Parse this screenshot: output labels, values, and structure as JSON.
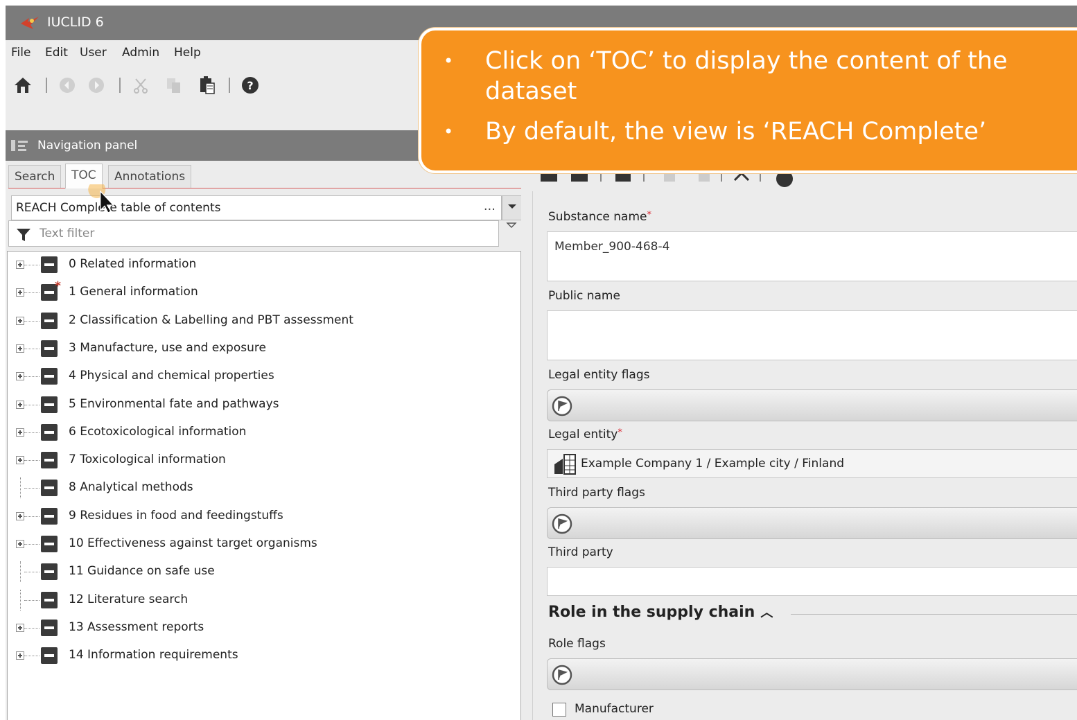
{
  "app": {
    "title": "IUCLID 6"
  },
  "menu": {
    "items": [
      "File",
      "Edit",
      "User",
      "Admin",
      "Help"
    ]
  },
  "toolbar": {
    "icons": [
      "home-icon",
      "back-icon",
      "forward-icon",
      "cut-icon",
      "copy-icon",
      "paste-icon",
      "help-icon"
    ]
  },
  "nav_panel": {
    "title": "Navigation panel",
    "tabs": [
      {
        "label": "Search",
        "active": false
      },
      {
        "label": "TOC",
        "active": true
      },
      {
        "label": "Annotations",
        "active": false
      }
    ],
    "toc_selector": {
      "value": "REACH Complete table of contents",
      "ellipsis": "..."
    },
    "filter": {
      "placeholder": "Text filter"
    },
    "tree": [
      {
        "label": "0 Related information",
        "expandable": true,
        "required": false
      },
      {
        "label": "1 General information",
        "expandable": true,
        "required": true
      },
      {
        "label": "2 Classification & Labelling and PBT assessment",
        "expandable": true,
        "required": false
      },
      {
        "label": "3 Manufacture, use and exposure",
        "expandable": true,
        "required": false
      },
      {
        "label": "4 Physical and chemical properties",
        "expandable": true,
        "required": false
      },
      {
        "label": "5 Environmental fate and pathways",
        "expandable": true,
        "required": false
      },
      {
        "label": "6 Ecotoxicological information",
        "expandable": true,
        "required": false
      },
      {
        "label": "7 Toxicological information",
        "expandable": true,
        "required": false
      },
      {
        "label": "8 Analytical methods",
        "expandable": false,
        "required": false
      },
      {
        "label": "9 Residues in food and feedingstuffs",
        "expandable": true,
        "required": false
      },
      {
        "label": "10 Effectiveness against target organisms",
        "expandable": true,
        "required": false
      },
      {
        "label": "11 Guidance on safe use",
        "expandable": false,
        "required": false
      },
      {
        "label": "12 Literature search",
        "expandable": false,
        "required": false
      },
      {
        "label": "13 Assessment reports",
        "expandable": true,
        "required": false
      },
      {
        "label": "14 Information requirements",
        "expandable": true,
        "required": false
      }
    ]
  },
  "form": {
    "substance_name": {
      "label": "Substance name",
      "required_mark": "*",
      "value": "Member_900-468-4"
    },
    "public_name": {
      "label": "Public name",
      "value": ""
    },
    "legal_entity_flags": {
      "label": "Legal entity flags"
    },
    "legal_entity": {
      "label": "Legal entity",
      "required_mark": "*",
      "value": "Example Company 1 / Example city / Finland"
    },
    "third_party_flags": {
      "label": "Third party flags"
    },
    "third_party": {
      "label": "Third party",
      "value": ""
    },
    "supply_chain": {
      "section_title": "Role in the supply chain",
      "role_flags": {
        "label": "Role flags"
      },
      "manufacturer": {
        "label": "Manufacturer",
        "checked": false
      }
    }
  },
  "callout": {
    "bullets": [
      "Click on ‘TOC’ to display the content of the dataset",
      "By default, the view is ‘REACH Complete’"
    ]
  },
  "colors": {
    "callout_bg": "#f7931e",
    "titlebar_bg": "#7b7b7b",
    "required_mark": "#d9232e"
  }
}
